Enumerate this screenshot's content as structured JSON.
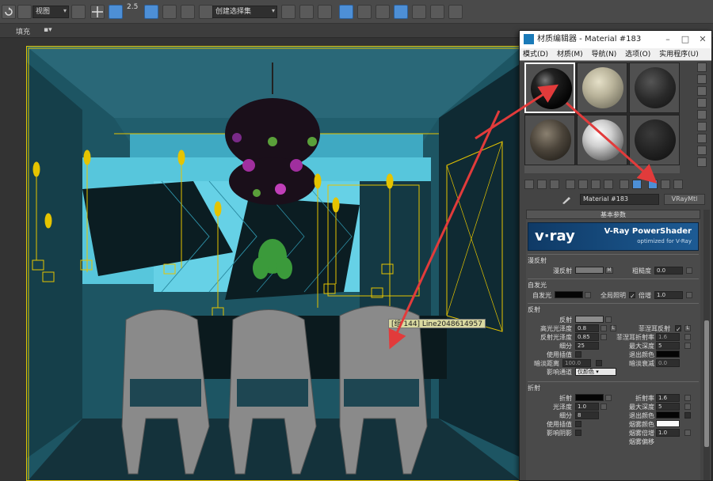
{
  "toolbar": {
    "view_combo": "视图",
    "selection_set_combo": "创建选择集",
    "snap_value": "2.5"
  },
  "sub_toolbar": {
    "fill_label": "填充"
  },
  "viewport": {
    "object_label": "[组 144] Line2048614957"
  },
  "material_editor": {
    "title": "材质编辑器 - Material #183",
    "menu": [
      "模式(D)",
      "材质(M)",
      "导航(N)",
      "选项(O)",
      "实用程序(U)"
    ],
    "material_name": "Material #183",
    "material_type": "VRayMtl",
    "rollout_title": "基本参数",
    "banner": {
      "logo": "v·ray",
      "title": "V-Ray PowerShader",
      "subtitle": "optimized for V-Ray"
    },
    "diffuse": {
      "section": "漫反射",
      "diffuse_label": "漫反射",
      "m_button": "M",
      "roughness_label": "粗糙度",
      "roughness_value": "0.0"
    },
    "self_illum": {
      "section": "自发光",
      "label": "自发光",
      "gi_label": "全局照明",
      "multiplier_label": "倍增",
      "multiplier_value": "1.0"
    },
    "reflection": {
      "section": "反射",
      "reflect_label": "反射",
      "hilight_gloss_label": "高光光泽度",
      "hilight_gloss_value": "0.8",
      "l_button": "L",
      "fresnel_label": "菲涅耳反射",
      "refl_gloss_label": "反射光泽度",
      "refl_gloss_value": "0.85",
      "fresnel_ior_label": "菲涅耳折射率",
      "fresnel_ior_value": "1.6",
      "subdivs_label": "细分",
      "subdivs_value": "25",
      "max_depth_label": "最大深度",
      "max_depth_value": "5",
      "use_interp_label": "使用插值",
      "exit_color_label": "退出颜色",
      "dim_distance_label": "暗淡距离",
      "dim_distance_value": "100.0",
      "dim_falloff_label": "暗淡衰减",
      "dim_falloff_value": "0.0",
      "affect_channels_label": "影响通道",
      "affect_channels_value": "仅颜色"
    },
    "refraction": {
      "section": "折射",
      "refract_label": "折射",
      "ior_label": "折射率",
      "ior_value": "1.6",
      "gloss_label": "光泽度",
      "gloss_value": "1.0",
      "max_depth_label": "最大深度",
      "max_depth_value": "5",
      "subdivs_label": "细分",
      "subdivs_value": "8",
      "exit_color_label": "退出颜色",
      "use_interp_label": "使用插值",
      "fog_color_label": "烟雾颜色",
      "affect_shadows_label": "影响阴影",
      "fog_mult_label": "烟雾倍增",
      "fog_mult_value": "1.0",
      "fog_bias_label": "烟雾偏移"
    }
  },
  "colors": {
    "viewport_bg": "#1d5563",
    "accent_blue": "#4d8fd6",
    "arrow_red": "#e23b3b",
    "frame_yellow": "#e5c400"
  }
}
